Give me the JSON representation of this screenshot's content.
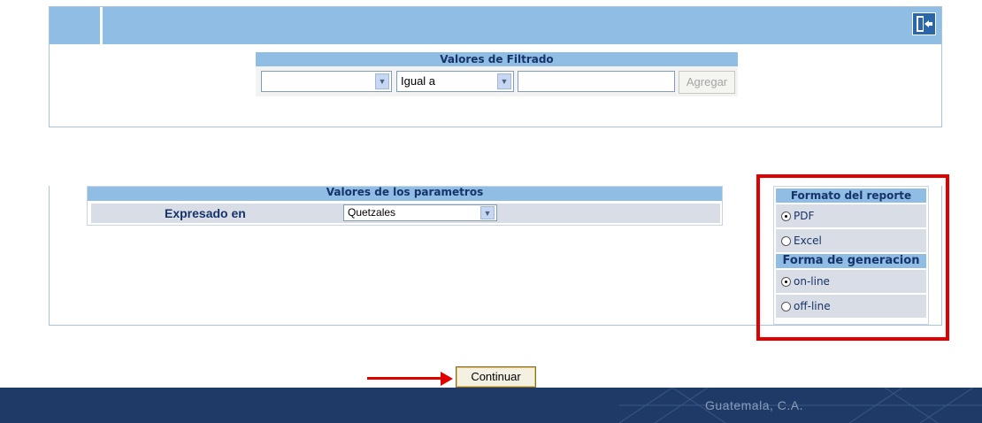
{
  "filter": {
    "title": "Valores de Filtrado",
    "field_value": "",
    "operator_value": "Igual a",
    "text_value": "",
    "add_label": "Agregar"
  },
  "params": {
    "title": "Valores de los parametros",
    "expresado_label": "Expresado en",
    "expresado_value": "Quetzales"
  },
  "format": {
    "title": "Formato del reporte",
    "options": [
      {
        "label": "PDF",
        "selected": true
      },
      {
        "label": "Excel",
        "selected": false
      }
    ]
  },
  "generation": {
    "title": "Forma de generacion",
    "options": [
      {
        "label": "on-line",
        "selected": true
      },
      {
        "label": "off-line",
        "selected": false
      }
    ]
  },
  "actions": {
    "continue_label": "Continuar"
  },
  "footer": {
    "text": "Guatemala, C.A."
  },
  "colors": {
    "header_blue": "#8fbde3",
    "footer_navy": "#1f3a66",
    "highlight_red": "#e10000",
    "label_navy": "#17336b"
  }
}
